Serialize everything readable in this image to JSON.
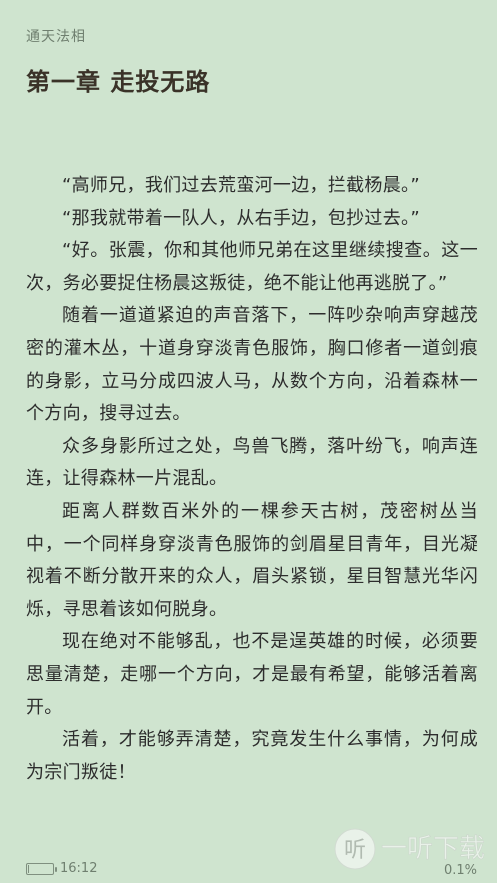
{
  "header": {
    "book_title": "通天法相",
    "chapter_title": "第一章 走投无路"
  },
  "content": {
    "paragraphs": [
      "“高师兄，我们过去荒蛮河一边，拦截杨晨。”",
      "“那我就带着一队人，从右手边，包抄过去。”",
      "“好。张震，你和其他师兄弟在这里继续搜查。这一次，务必要捉住杨晨这叛徒，绝不能让他再逃脱了。”",
      "随着一道道紧迫的声音落下，一阵吵杂响声穿越茂密的灌木丛，十道身穿淡青色服饰，胸口修者一道剑痕的身影，立马分成四波人马，从数个方向，沿着森林一个方向，搜寻过去。",
      "众多身影所过之处，鸟兽飞腾，落叶纷飞，响声连连，让得森林一片混乱。",
      "距离人群数百米外的一棵参天古树，茂密树丛当中，一个同样身穿淡青色服饰的剑眉星目青年，目光凝视着不断分散开来的众人，眉头紧锁，星目智慧光华闪烁，寻思着该如何脱身。",
      "现在绝对不能够乱，也不是逞英雄的时候，必须要思量清楚，走哪一个方向，才是最有希望，能够活着离开。",
      "活着，才能够弄清楚，究竟发生什么事情，为何成为宗门叛徒！"
    ]
  },
  "status": {
    "time": "16:12",
    "progress": "0.1%",
    "battery_level": 0.05
  },
  "watermark": {
    "text": "一听下载",
    "logo_char": "听"
  },
  "colors": {
    "background": "#cfe4cf",
    "text": "#2d2d2d",
    "muted": "#6f7f6f"
  }
}
